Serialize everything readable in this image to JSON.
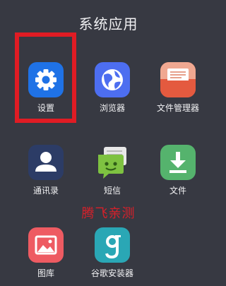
{
  "header": {
    "title": "系统应用"
  },
  "apps": [
    {
      "label": "设置",
      "icon": "gear-icon",
      "color": "#1f72e6"
    },
    {
      "label": "浏览器",
      "icon": "browser-planet-icon",
      "color": "#4d6ef0"
    },
    {
      "label": "文件管理器",
      "icon": "file-manager-icon",
      "color": "#e45a3f"
    },
    {
      "label": "通讯录",
      "icon": "contact-person-icon",
      "color": "#2c3c66"
    },
    {
      "label": "短信",
      "icon": "sms-message-icon",
      "color": "#7ec241"
    },
    {
      "label": "文件",
      "icon": "download-icon",
      "color": "#55b36d"
    },
    {
      "label": "图库",
      "icon": "gallery-image-icon",
      "color": "#ee5b62"
    },
    {
      "label": "谷歌安装器",
      "icon": "google-installer-icon",
      "color": "#2aa7b5"
    }
  ],
  "watermark": {
    "text": "腾飞亲测"
  },
  "highlight_color": "#e01c24"
}
